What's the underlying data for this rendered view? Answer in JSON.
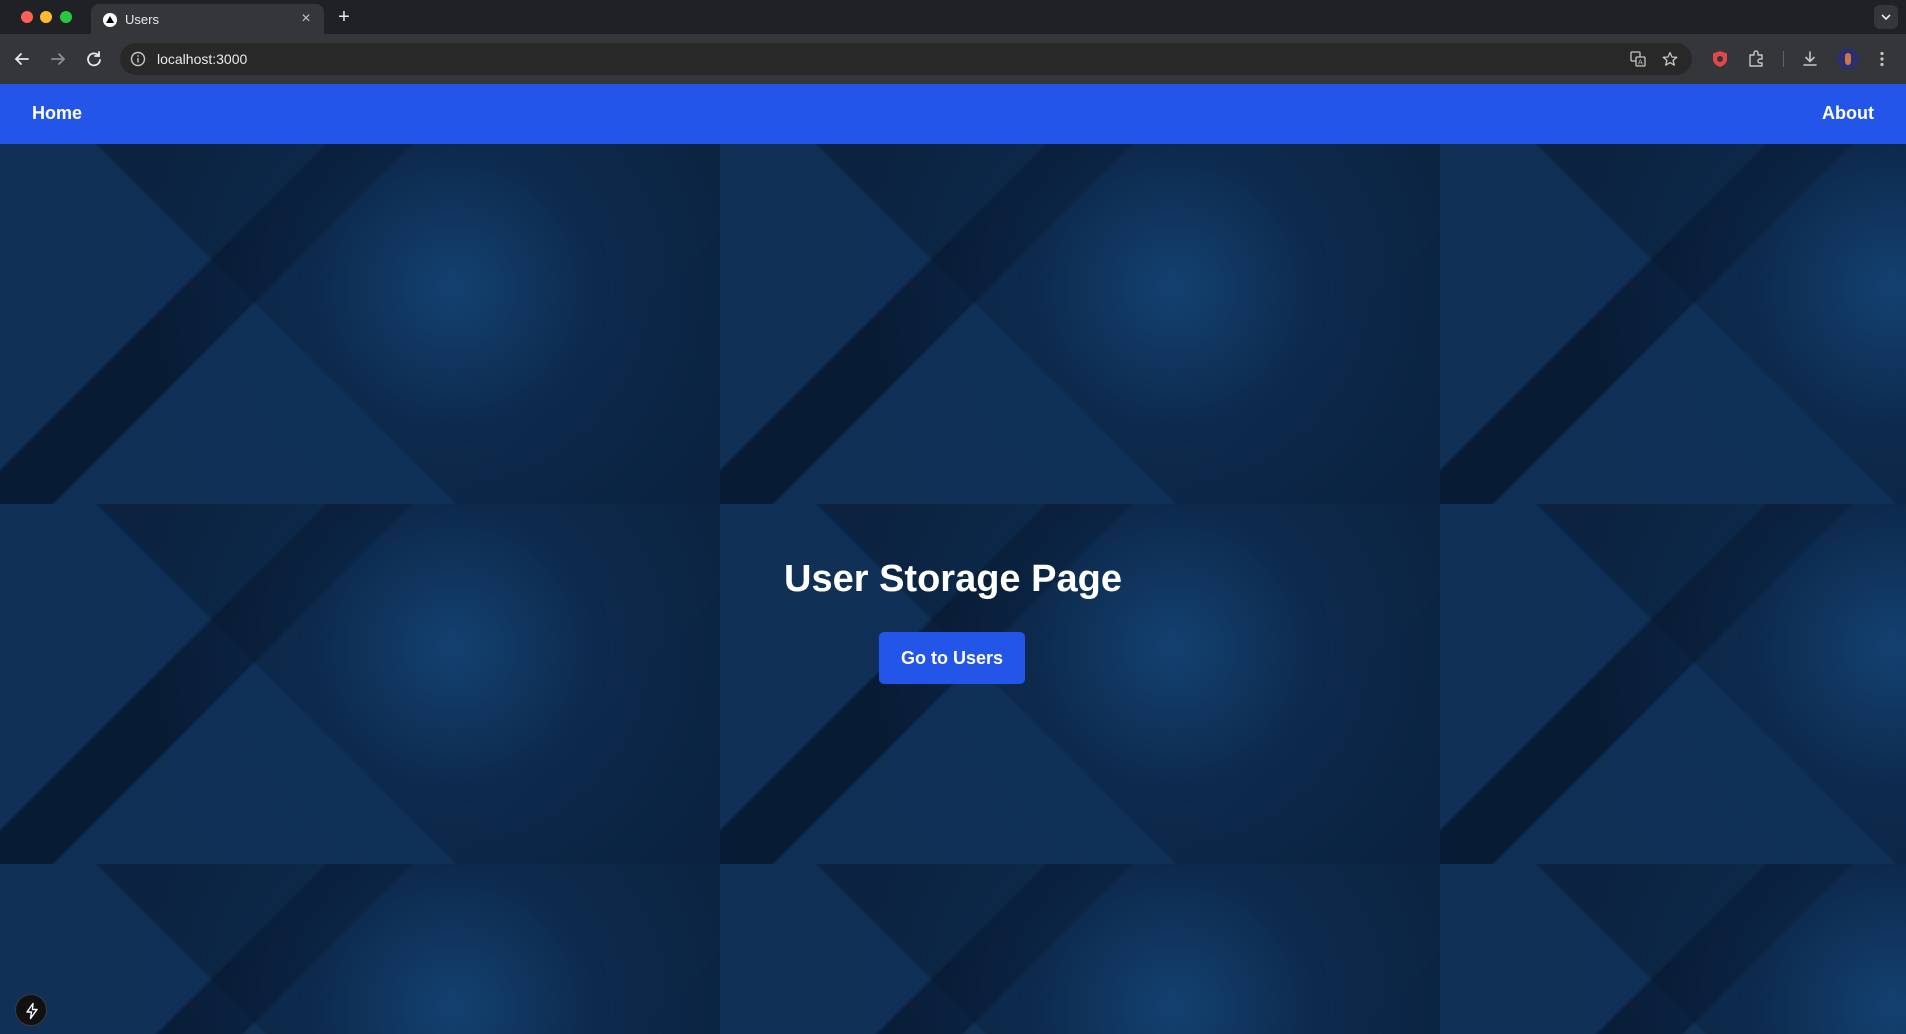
{
  "browser": {
    "tab_title": "Users",
    "url": "localhost:3000",
    "icons": {
      "back": "arrow-left-icon",
      "forward": "arrow-right-icon",
      "reload": "reload-icon",
      "site_info": "info-icon",
      "translate": "translate-icon",
      "bookmark": "star-icon",
      "extension_shield": "shield-icon",
      "extensions": "puzzle-icon",
      "downloads": "download-icon",
      "menu": "kebab-menu-icon"
    }
  },
  "navbar": {
    "home_label": "Home",
    "about_label": "About",
    "background": "#2255e8"
  },
  "hero": {
    "title": "User Storage Page",
    "button_label": "Go to Users",
    "button_color": "#2255e8"
  }
}
